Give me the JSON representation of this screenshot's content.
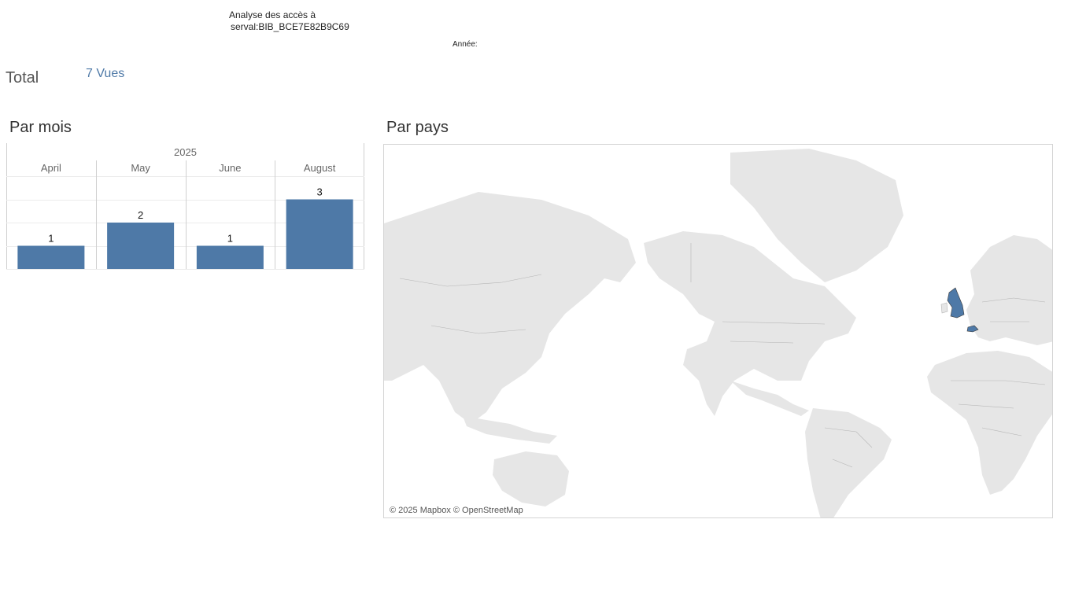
{
  "header": {
    "title_line1": "Analyse des accès à",
    "title_line2": "serval:BIB_BCE7E82B9C69",
    "year_filter_label": "Année:"
  },
  "summary": {
    "total_label": "Total",
    "total_value": "7 Vues"
  },
  "sections": {
    "by_month_title": "Par mois",
    "by_country_title": "Par pays"
  },
  "chart_data": {
    "type": "bar",
    "title": "Par mois",
    "group_label": "2025",
    "categories": [
      "April",
      "May",
      "June",
      "August"
    ],
    "values": [
      1,
      2,
      1,
      3
    ],
    "ylim": [
      0,
      4
    ],
    "grid": true,
    "bar_color": "#4e79a7"
  },
  "map": {
    "attribution": "© 2025 Mapbox © OpenStreetMap",
    "highlighted_countries": [
      "United Kingdom",
      "Switzerland"
    ],
    "highlight_color": "#4e79a7",
    "land_color": "#e6e6e6"
  }
}
